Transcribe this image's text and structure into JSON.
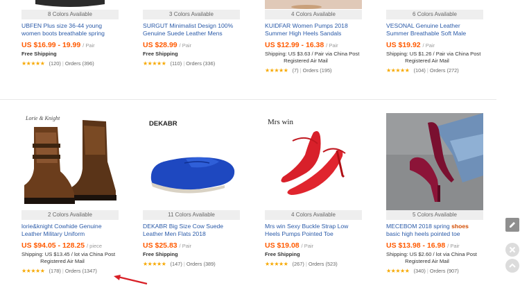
{
  "colors": {
    "price": "#ff5a00",
    "title": "#2a5aa8",
    "stars": "#f7a800",
    "arrow": "#d81f26"
  },
  "row1": [
    {
      "colors": "8 Colors Available",
      "title": "UBFEN Plus size 36-44 young women boots breathable spring",
      "price": "US $16.99 - 19.99",
      "unit": "/ Pair",
      "ship": "Free Shipping",
      "ship2": "",
      "stars": "★★★★★",
      "reviews": "(120)",
      "orders": "Orders (396)"
    },
    {
      "colors": "3 Colors Available",
      "title": "SURGUT Minimalist Design 100% Genuine Suede Leather Mens",
      "price": "US $28.99",
      "unit": "/ Pair",
      "ship": "Free Shipping",
      "ship2": "",
      "stars": "★★★★★",
      "reviews": "(110)",
      "orders": "Orders (336)"
    },
    {
      "colors": "4 Colors Available",
      "title": "KUIDFAR Women Pumps 2018 Summer High Heels Sandals",
      "price": "US $12.99 - 16.38",
      "unit": "/ Pair",
      "ship": "Shipping: US $3.63 / Pair via China Post",
      "ship2": "Registered Air Mail",
      "stars": "★★★★★",
      "reviews": "(7)",
      "orders": "Orders (195)"
    },
    {
      "colors": "6 Colors Available",
      "title": "VESONAL Genuine Leather Summer Breathable Soft Male",
      "price": "US $19.92",
      "unit": "/ Pair",
      "ship": "Shipping: US $1.26 / Pair via China Post",
      "ship2": "Registered Air Mail",
      "stars": "★★★★★",
      "reviews": "(104)",
      "orders": "Orders (272)"
    }
  ],
  "row2": [
    {
      "brand": "Lorie & Knight",
      "colors": "2 Colors Available",
      "title": "lorie&knight Cowhide Genuine Leather Military Uniform",
      "price": "US $94.05 - 128.25",
      "unit": "/ piece",
      "ship": "Shipping: US $13.45 / lot via China Post",
      "ship2": "Registered Air Mail",
      "stars": "★★★★★",
      "reviews": "(178)",
      "orders": "Orders (1347)"
    },
    {
      "brand": "DEKABR",
      "colors": "11 Colors Available",
      "title": "DEKABR Big Size Cow Suede Leather Men Flats 2018",
      "price": "US $25.83",
      "unit": "/ Pair",
      "ship": "Free Shipping",
      "ship2": "",
      "stars": "★★★★★",
      "reviews": "(147)",
      "orders": "Orders (389)"
    },
    {
      "brand": "Mrs win",
      "colors": "4 Colors Available",
      "title": "Mrs win Sexy Buckle Strap Low Heels Pumps Pointed Toe",
      "price": "US $19.08",
      "unit": "/ Pair",
      "ship": "Free Shipping",
      "ship2": "",
      "stars": "★★★★★",
      "reviews": "(267)",
      "orders": "Orders (523)"
    },
    {
      "colors": "5 Colors Available",
      "title_a": "MECEBOM 2018 spring",
      "title_kw": "shoes",
      "title_b": "basic high heels pointed toe",
      "price": "US $13.98 - 16.98",
      "unit": "/ Pair",
      "ship": "Shipping: US $2.60 / lot via China Post",
      "ship2": "Registered Air Mail",
      "stars": "★★★★★",
      "reviews": "(340)",
      "orders": "Orders (907)"
    }
  ],
  "sidebar": {
    "edit": "edit-pen-icon",
    "close": "close-icon",
    "up": "scroll-up-icon"
  }
}
